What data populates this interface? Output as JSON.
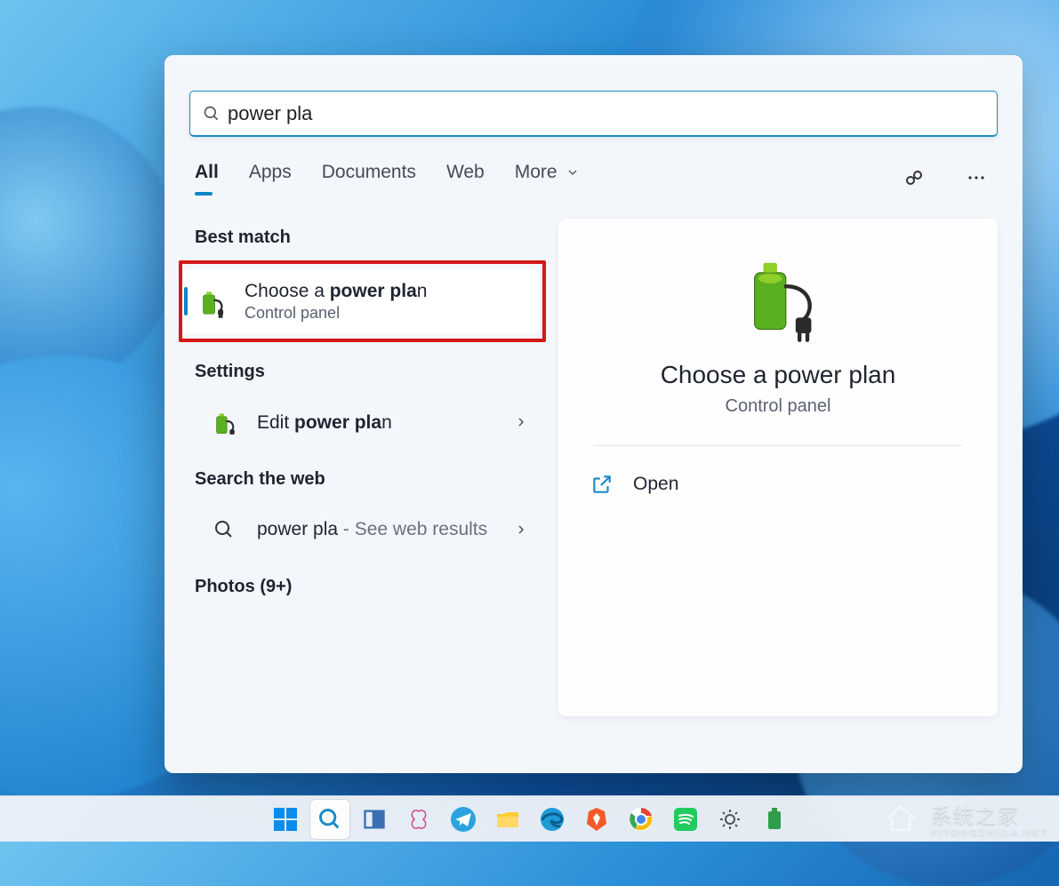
{
  "search": {
    "query": "power pla"
  },
  "tabs": {
    "all": "All",
    "apps": "Apps",
    "documents": "Documents",
    "web": "Web",
    "more": "More"
  },
  "sections": {
    "best_match": "Best match",
    "settings": "Settings",
    "search_web": "Search the web",
    "photos": "Photos (9+)"
  },
  "results": {
    "best": {
      "title_prefix": "Choose a ",
      "title_bold": "power pla",
      "title_suffix": "n",
      "sub": "Control panel"
    },
    "settings_item": {
      "title_prefix": "Edit ",
      "title_bold": "power pla",
      "title_suffix": "n"
    },
    "web_item": {
      "query": "power pla",
      "dash": " - See web results"
    }
  },
  "preview": {
    "title": "Choose a power plan",
    "sub": "Control panel",
    "open_label": "Open"
  },
  "watermark": {
    "zh": "系统之家",
    "en": "XITONGZHIJIA.NET"
  }
}
